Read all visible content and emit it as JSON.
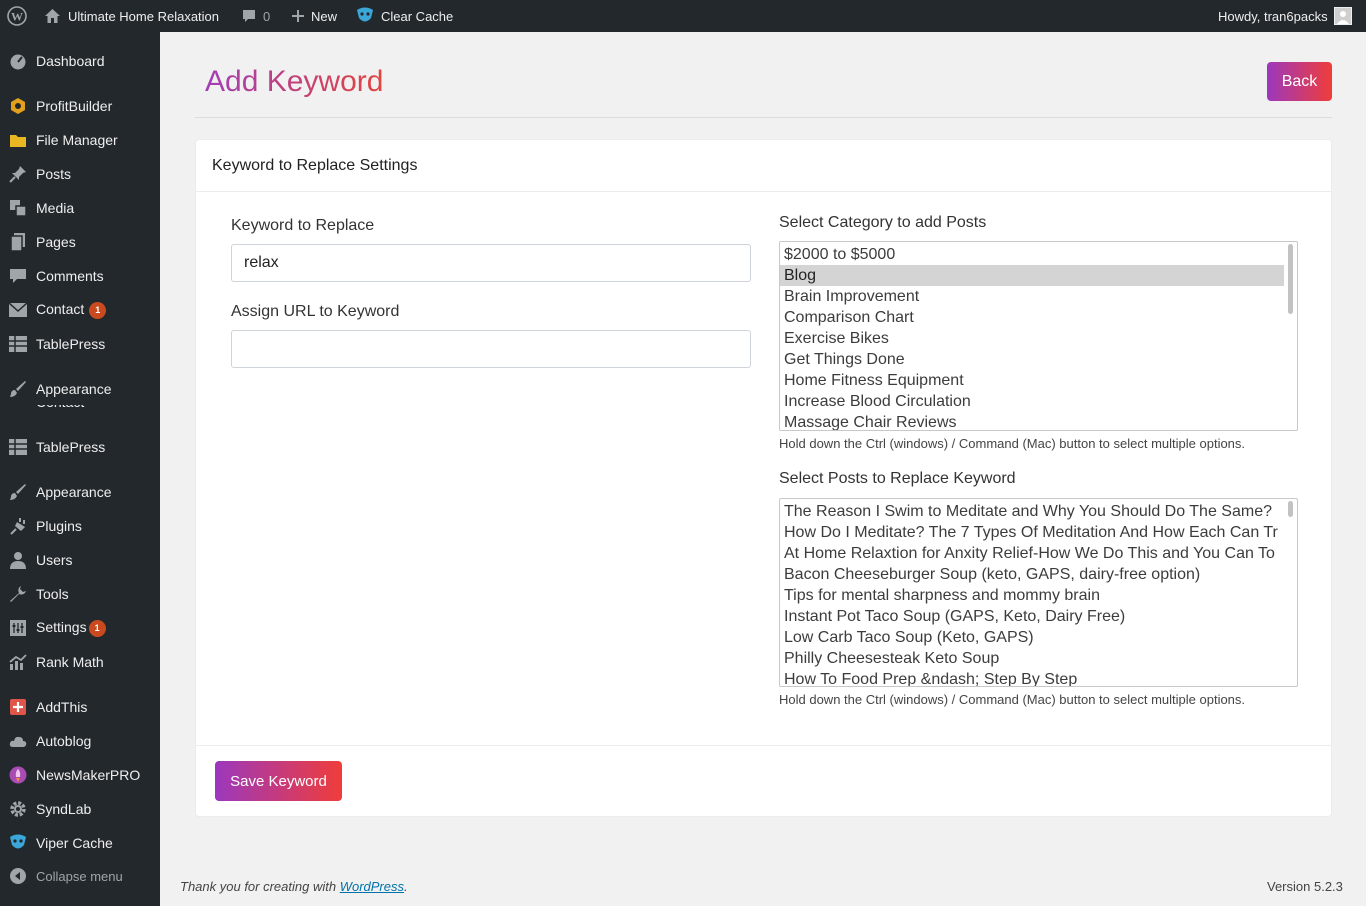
{
  "adminbar": {
    "site_name": "Ultimate Home Relaxation",
    "comments_count": "0",
    "new_label": "New",
    "clear_cache_label": "Clear Cache",
    "howdy": "Howdy, tran6packs"
  },
  "sidebar": {
    "items": [
      {
        "label": "Dashboard",
        "icon": "dashboard-icon"
      },
      {
        "label": "ProfitBuilder",
        "icon": "profitbuilder-icon"
      },
      {
        "label": "File Manager",
        "icon": "folder-icon"
      },
      {
        "label": "Posts",
        "icon": "pin-icon"
      },
      {
        "label": "Media",
        "icon": "media-icon"
      },
      {
        "label": "Pages",
        "icon": "pages-icon"
      },
      {
        "label": "Comments",
        "icon": "comment-icon"
      },
      {
        "label": "Contact",
        "icon": "mail-icon",
        "badge": "1"
      },
      {
        "label": "TablePress",
        "icon": "table-icon"
      },
      {
        "label": "Appearance",
        "icon": "brush-icon"
      },
      {
        "label": "TablePress",
        "icon": "table-icon"
      },
      {
        "label": "Appearance",
        "icon": "brush-icon"
      },
      {
        "label": "Plugins",
        "icon": "plug-icon"
      },
      {
        "label": "Users",
        "icon": "user-icon"
      },
      {
        "label": "Tools",
        "icon": "wrench-icon"
      },
      {
        "label": "Settings",
        "icon": "settings-icon",
        "badge": "1"
      },
      {
        "label": "Rank Math",
        "icon": "chart-icon"
      },
      {
        "label": "AddThis",
        "icon": "plus-square-icon"
      },
      {
        "label": "Autoblog",
        "icon": "cloud-icon"
      },
      {
        "label": "NewsMakerPRO",
        "icon": "rocket-icon"
      },
      {
        "label": "SyndLab",
        "icon": "gear-icon"
      },
      {
        "label": "Viper Cache",
        "icon": "viper-icon"
      }
    ],
    "collapse_label": "Collapse menu"
  },
  "page": {
    "title": "Add Keyword",
    "back_label": "Back"
  },
  "card": {
    "header": "Keyword to Replace Settings",
    "keyword_label": "Keyword to Replace",
    "keyword_value": "relax",
    "url_label": "Assign URL to Keyword",
    "url_value": "",
    "category_label": "Select Category to add Posts",
    "categories": [
      "$2000 to $5000",
      "Blog",
      "Brain Improvement",
      "Comparison Chart",
      "Exercise Bikes",
      "Get Things Done",
      "Home Fitness Equipment",
      "Increase Blood Circulation",
      "Massage Chair Reviews"
    ],
    "selected_category": "Blog",
    "posts_label": "Select Posts to Replace Keyword",
    "posts": [
      "The Reason I Swim to Meditate and Why You Should Do The Same?",
      "How Do I Meditate? The 7 Types Of Meditation And How Each Can Tr",
      "At Home Relaxtion for Anxity Relief-How We Do This and You Can To",
      "Bacon Cheeseburger Soup (keto, GAPS, dairy-free option)",
      "Tips for mental sharpness and mommy brain",
      "Instant Pot Taco Soup (GAPS, Keto, Dairy Free)",
      "Low Carb Taco Soup (Keto, GAPS)",
      "Philly Cheesesteak Keto Soup",
      "How To Food Prep &ndash; Step By Step"
    ],
    "help_text": "Hold down the Ctrl (windows) / Command (Mac) button to select multiple options.",
    "save_label": "Save Keyword"
  },
  "footer": {
    "thanks_prefix": "Thank you for creating with ",
    "thanks_link": "WordPress",
    "thanks_suffix": ".",
    "version": "Version 5.2.3"
  },
  "colors": {
    "adminbar_bg": "#23282d",
    "accent_gradient_start": "#9c38bd",
    "accent_gradient_end": "#ef3d3a",
    "badge": "#ca4a1f",
    "link": "#0073aa"
  }
}
